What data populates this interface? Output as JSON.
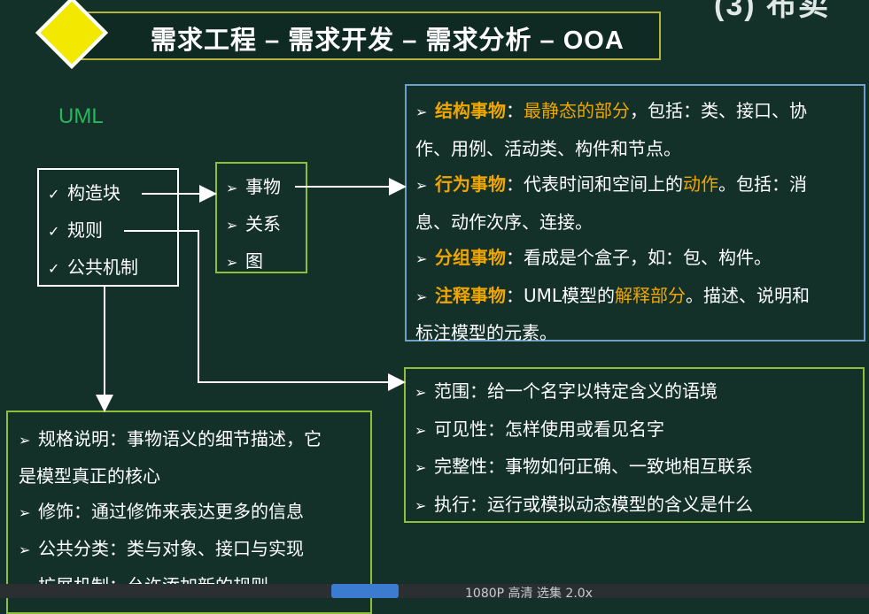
{
  "corner_text": "(3) 布卖",
  "title": "需求工程 – 需求开发 – 需求分析 – OOA",
  "uml_label": "UML",
  "left_box": [
    "构造块",
    "规则",
    "公共机制"
  ],
  "mid_box": [
    "事物",
    "关系",
    "图"
  ],
  "things_box": {
    "structural_kw": "结构事物",
    "structural_sep": "：",
    "structural_hl": "最静态的部分",
    "structural_rest1": "，包括：类、接口、协",
    "structural_rest2": "作、用例、活动类、构件和节点。",
    "behavior_kw": "行为事物",
    "behavior_rest1": "：代表时间和空间上的",
    "behavior_hl": "动作",
    "behavior_rest2": "。包括：消",
    "behavior_rest3": "息、动作次序、连接。",
    "group_kw": "分组事物",
    "group_rest": "：看成是个盒子，如：包、构件。",
    "note_kw": "注释事物",
    "note_rest1": "：UML模型的",
    "note_hl": "解释部分",
    "note_rest2": "。描述、说明和",
    "note_rest3": "标注模型的元素。"
  },
  "rules_box": [
    "范围：给一个名字以特定含义的语境",
    "可见性：怎样使用或看见名字",
    "完整性：事物如何正确、一致地相互联系",
    "执行：运行或模拟动态模型的含义是什么"
  ],
  "mechanisms_box": {
    "line1": "规格说明：事物语义的细节描述，它",
    "line2": "是模型真正的核心",
    "line3": "修饰：通过修饰来表达更多的信息",
    "line4": "公共分类：类与对象、接口与实现",
    "line5": "扩展机制：允许添加新的规则"
  },
  "player": {
    "status": "1080P 高清     选集     2.0x"
  },
  "icons": {
    "check": "check-icon",
    "arrow_bullet": "arrow-bullet-icon"
  },
  "colors": {
    "background": "#133029",
    "accent_orange": "#f0a600",
    "uml_green": "#27b85c",
    "diamond_yellow": "#f2e800"
  }
}
